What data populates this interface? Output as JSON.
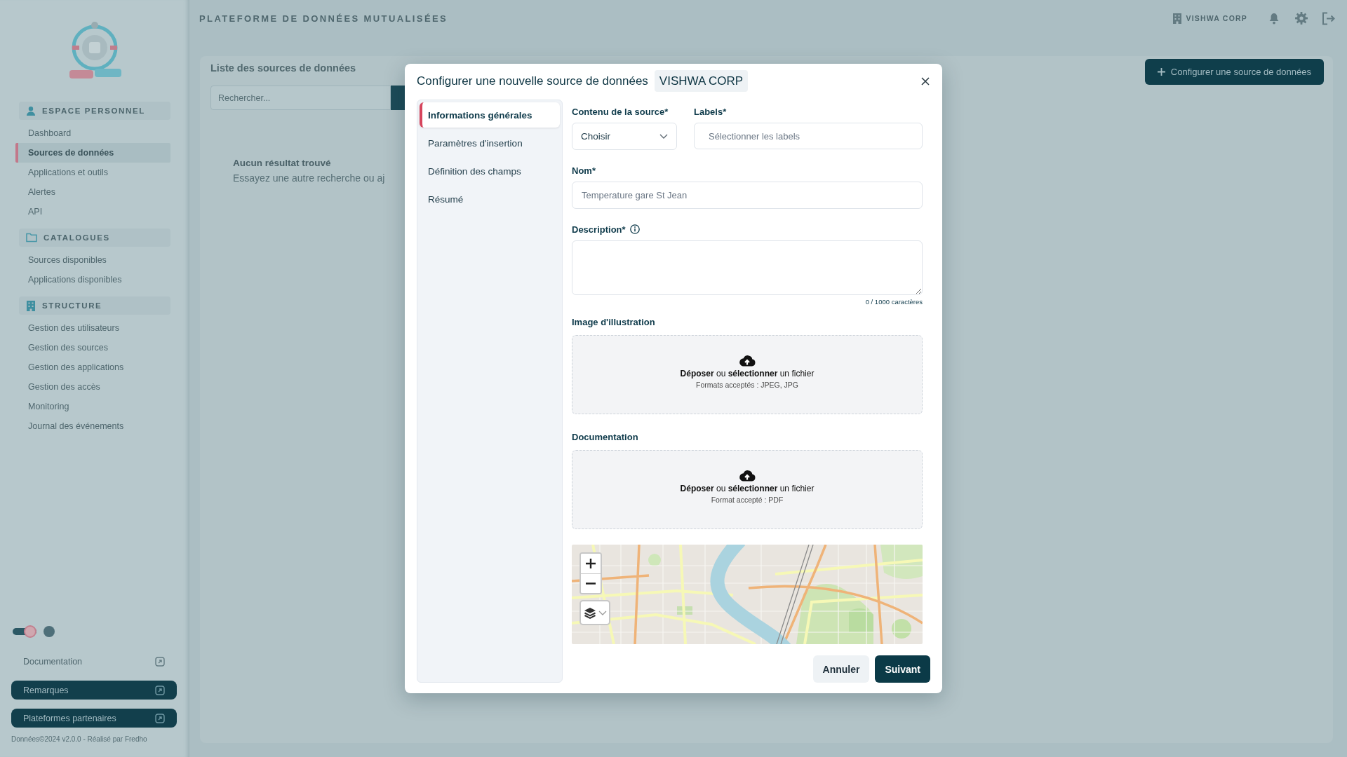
{
  "sidebar": {
    "sections": [
      {
        "title": "ESPACE PERSONNEL",
        "items": [
          {
            "label": "Dashboard",
            "selected": false
          },
          {
            "label": "Sources de données",
            "selected": true
          },
          {
            "label": "Applications et outils",
            "selected": false
          },
          {
            "label": "Alertes",
            "selected": false
          },
          {
            "label": "API",
            "selected": false
          }
        ]
      },
      {
        "title": "CATALOGUES",
        "items": [
          {
            "label": "Sources disponibles",
            "selected": false
          },
          {
            "label": "Applications disponibles",
            "selected": false
          }
        ]
      },
      {
        "title": "STRUCTURE",
        "items": [
          {
            "label": "Gestion des utilisateurs",
            "selected": false
          },
          {
            "label": "Gestion des sources",
            "selected": false
          },
          {
            "label": "Gestion des applications",
            "selected": false
          },
          {
            "label": "Gestion des accès",
            "selected": false
          },
          {
            "label": "Monitoring",
            "selected": false
          },
          {
            "label": "Journal des événements",
            "selected": false
          }
        ]
      }
    ],
    "theme_toggle": {
      "on": true
    },
    "documentation_link": "Documentation",
    "buttons": [
      "Remarques",
      "Plateformes partenaires"
    ],
    "footer": "Données©2024 v2.0.0 - Réalisé par Fredho"
  },
  "header": {
    "title": "PLATEFORME DE DONNÉES MUTUALISÉES",
    "organization": "VISHWA CORP"
  },
  "page": {
    "title": "Liste des sources de données",
    "search": {
      "placeholder": "Rechercher..."
    },
    "add_button": "Configurer une source de données",
    "empty_state": {
      "title": "Aucun résultat trouvé",
      "hint": "Essayez une autre recherche ou aj"
    }
  },
  "modal": {
    "title": "Configurer une nouvelle source de données",
    "badge": "VISHWA CORP",
    "steps": [
      {
        "label": "Informations générales",
        "selected": true
      },
      {
        "label": "Paramètres d'insertion",
        "selected": false
      },
      {
        "label": "Définition des champs",
        "selected": false
      },
      {
        "label": "Résumé",
        "selected": false
      }
    ],
    "fields": [
      {
        "kind": "select",
        "label": "Contenu de la source*",
        "value": "Choisir",
        "info": false
      },
      {
        "kind": "tags",
        "label": "Labels*",
        "placeholder": "Sélectionner les labels",
        "info": false
      },
      {
        "kind": "text",
        "label": "Nom*",
        "placeholder": "Temperature gare St Jean",
        "info": false
      },
      {
        "kind": "textarea",
        "label": "Description*",
        "info": true,
        "counter": "0 / 1000 caractères"
      },
      {
        "kind": "upload",
        "label": "Image d'illustration",
        "info": false,
        "prompt": "**Déposer** ou **sélectionner** un fichier",
        "hint": "Formats acceptés : JPEG, JPG"
      },
      {
        "kind": "upload",
        "label": "Documentation",
        "info": false,
        "prompt": "**Déposer** ou **sélectionner** un fichier",
        "hint": "Format accepté : PDF"
      },
      {
        "kind": "map"
      }
    ],
    "buttons": [
      {
        "label": "Annuler",
        "kind": "secondary"
      },
      {
        "label": "Suivant",
        "kind": "primary"
      }
    ]
  }
}
